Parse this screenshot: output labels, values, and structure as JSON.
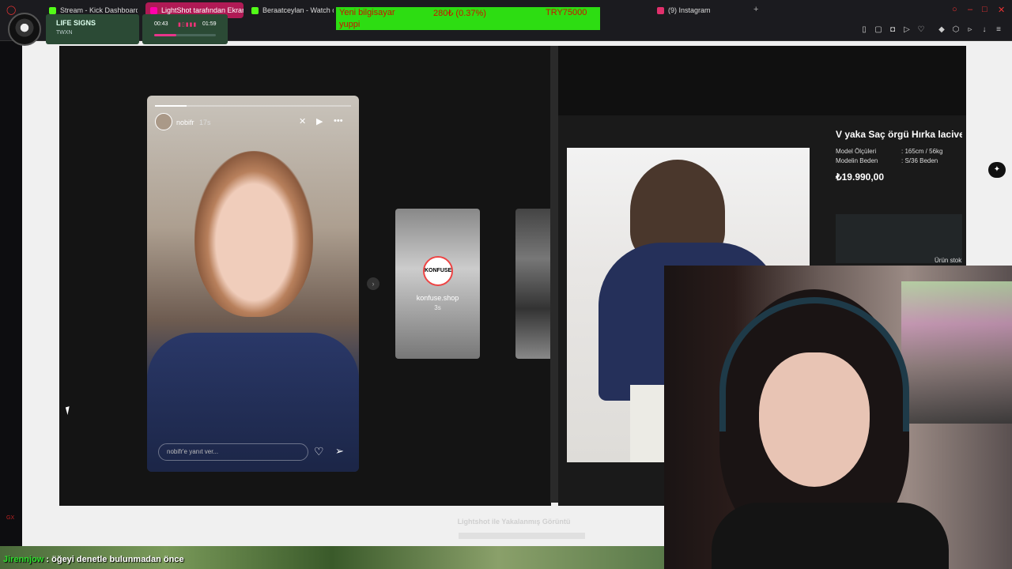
{
  "browser": {
    "tabs": [
      {
        "label": "Stream - Kick Dashboard",
        "color": "#53fc18"
      },
      {
        "label": "LightShot tarafından Ekran",
        "color": "#d63384",
        "active": true
      },
      {
        "label": "Beraatceylan - Watch cli",
        "color": "#53fc18"
      },
      {
        "label": "(9) Instagram",
        "color": "#e1306c"
      }
    ],
    "new_tab": "+"
  },
  "overlay": {
    "song": {
      "title": "LIFE SIGNS",
      "artist": "TWXN",
      "time_now": "00:43",
      "time_total": "01:59",
      "progress": 0.36
    },
    "donation": {
      "user": "Yeni bilgisayar",
      "amount": "280₺ (0.37%)",
      "goal": "TRY75000",
      "message": "yuppi"
    }
  },
  "story": {
    "username": "nobifr",
    "time": "17s",
    "reply_placeholder": "nobifr'e yanıt ver...",
    "next": {
      "badge": "KONFUSE",
      "username": "konfuse.shop",
      "time": "3s"
    }
  },
  "product": {
    "title": "V yaka Saç örgü Hırka lacivert",
    "specs": [
      {
        "label": "Model Ölçüleri",
        "value": ": 165cm / 56kg"
      },
      {
        "label": "Modelin Beden",
        "value": ": S/36 Beden"
      }
    ],
    "price": "₺19.990,00",
    "stock_label": "Ürün stok"
  },
  "notification": {
    "title": "Lightshot ile Yakalanmış Görüntü"
  },
  "chat": {
    "user": "Jirennjow",
    "message": ": öğeyi denetle bulunmadan önce"
  },
  "sidebar": {
    "gx_label": "GX"
  }
}
